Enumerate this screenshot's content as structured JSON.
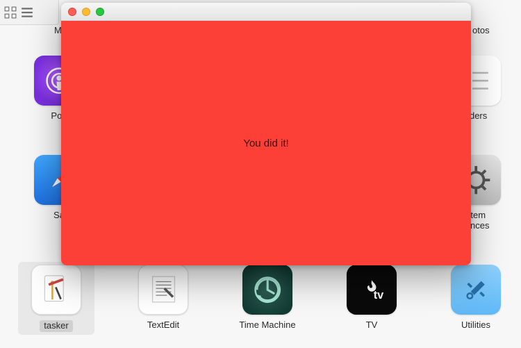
{
  "toolbar": {
    "view_mode": "icon"
  },
  "overlay": {
    "message": "You did it!",
    "traffic": {
      "close": "close",
      "min": "minimize",
      "max": "zoom"
    }
  },
  "peek": {
    "row1_left": "M",
    "row1_right": "otos",
    "row2_left": "Pod",
    "row2_right": "nders",
    "row3_left": "Sa",
    "row3_right": "stem\nrences"
  },
  "apps": {
    "podcasts": {
      "label": "Podcasts"
    },
    "reminders": {
      "label": "Reminders"
    },
    "safari": {
      "label": "Safari"
    },
    "settings": {
      "label": "System\nPreferences"
    },
    "tasker": {
      "label": "tasker"
    },
    "textedit": {
      "label": "TextEdit"
    },
    "timemachine": {
      "label": "Time Machine"
    },
    "tv": {
      "label": "TV"
    },
    "utilities": {
      "label": "Utilities"
    }
  }
}
